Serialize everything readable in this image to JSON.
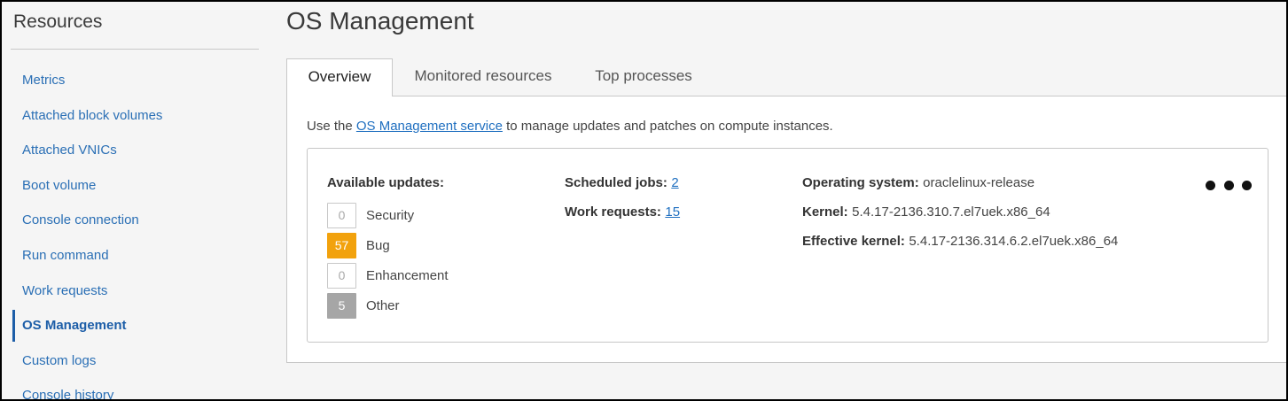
{
  "sidebar": {
    "title": "Resources",
    "items": [
      {
        "label": "Metrics"
      },
      {
        "label": "Attached block volumes"
      },
      {
        "label": "Attached VNICs"
      },
      {
        "label": "Boot volume"
      },
      {
        "label": "Console connection"
      },
      {
        "label": "Run command"
      },
      {
        "label": "Work requests"
      },
      {
        "label": "OS Management"
      },
      {
        "label": "Custom logs"
      },
      {
        "label": "Console history"
      }
    ],
    "active_item": "OS Management"
  },
  "page": {
    "title": "OS Management"
  },
  "tabs": [
    {
      "label": "Overview",
      "active": true
    },
    {
      "label": "Monitored resources",
      "active": false
    },
    {
      "label": "Top processes",
      "active": false
    }
  ],
  "overview": {
    "intro_prefix": "Use the ",
    "intro_link": "OS Management service",
    "intro_suffix": " to manage updates and patches on compute instances.",
    "available_updates_label": "Available updates:",
    "updates": [
      {
        "count": "0",
        "label": "Security",
        "color": "#ffffff"
      },
      {
        "count": "57",
        "label": "Bug",
        "color": "#f2a20d"
      },
      {
        "count": "0",
        "label": "Enhancement",
        "color": "#ffffff"
      },
      {
        "count": "5",
        "label": "Other",
        "color": "#a6a6a6"
      }
    ],
    "scheduled_jobs_label": "Scheduled jobs:",
    "scheduled_jobs_value": "2",
    "work_requests_label": "Work requests:",
    "work_requests_value": "15",
    "os_label": "Operating system:",
    "os_value": "oraclelinux-release",
    "kernel_label": "Kernel:",
    "kernel_value": "5.4.17-2136.310.7.el7uek.x86_64",
    "effective_kernel_label": "Effective kernel:",
    "effective_kernel_value": "5.4.17-2136.314.6.2.el7uek.x86_64",
    "actions_icon": "more-horizontal-icon"
  },
  "colors": {
    "link": "#1f6fc0",
    "bug_badge": "#f2a20d",
    "other_badge": "#a6a6a6"
  }
}
